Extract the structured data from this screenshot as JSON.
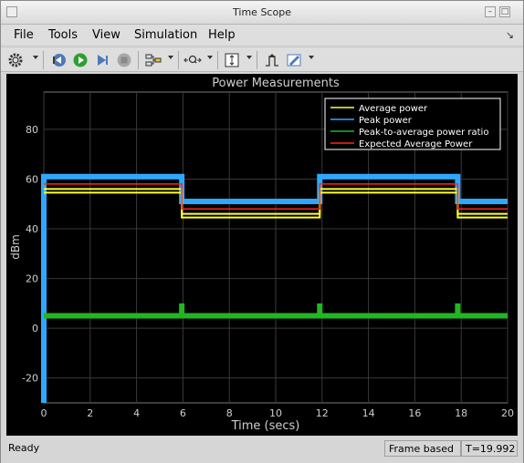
{
  "window": {
    "title": "Time Scope"
  },
  "menu": {
    "file": "File",
    "tools": "Tools",
    "view": "View",
    "simulation": "Simulation",
    "help": "Help"
  },
  "toolbar": {
    "icons": [
      "gear-icon",
      "step-back-icon",
      "run-icon",
      "step-forward-icon",
      "stop-icon",
      "signal-routing-icon",
      "zoom-icon",
      "autoscale-icon",
      "trigger-icon",
      "cursor-measurement-icon"
    ]
  },
  "chart_data": {
    "type": "line",
    "title": "Power Measurements",
    "xlabel": "Time (secs)",
    "ylabel": "dBm",
    "xlim": [
      0,
      20
    ],
    "ylim": [
      -30,
      95
    ],
    "xticks": [
      0,
      2,
      4,
      6,
      8,
      10,
      12,
      14,
      16,
      18,
      20
    ],
    "yticks": [
      -20,
      0,
      20,
      40,
      60,
      80
    ],
    "grid": true,
    "legend_position": "top-right",
    "background": "#000000",
    "series": [
      {
        "name": "Peak power",
        "color": "#2ea8ff",
        "x": [
          0,
          0,
          5.95,
          5.95,
          11.9,
          11.9,
          17.85,
          17.85,
          20
        ],
        "y": [
          -30,
          61,
          61,
          51,
          51,
          61,
          61,
          51,
          51
        ]
      },
      {
        "name": "Average power",
        "color": "#ffff33",
        "x": [
          0,
          5.95,
          5.95,
          11.9,
          11.9,
          17.85,
          17.85,
          20
        ],
        "y": [
          56,
          56,
          46,
          46,
          56,
          56,
          46,
          46
        ]
      },
      {
        "name": "Peak-to-average power ratio",
        "color": "#22b622",
        "x": [
          0,
          5.95,
          5.95,
          5.95,
          11.9,
          11.9,
          11.9,
          17.85,
          17.85,
          17.85,
          20
        ],
        "y": [
          5,
          5,
          10,
          5,
          5,
          10,
          5,
          5,
          10,
          5,
          5
        ]
      },
      {
        "name": "Expected Average Power",
        "color": "#ff2222",
        "x": [
          0,
          5.95,
          5.95,
          11.9,
          11.9,
          17.85,
          17.85,
          20
        ],
        "y": [
          58,
          58,
          48,
          48,
          58,
          58,
          48,
          48
        ]
      }
    ]
  },
  "status": {
    "state": "Ready",
    "mode": "Frame based",
    "time": "T=19.992"
  }
}
